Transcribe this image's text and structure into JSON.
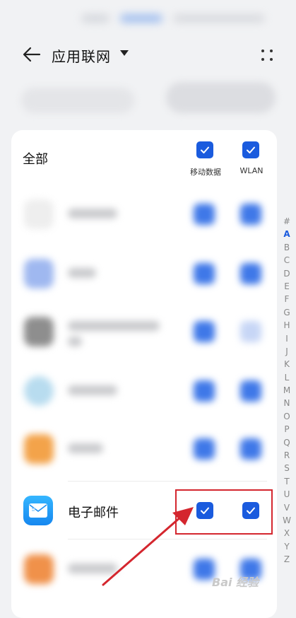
{
  "header": {
    "title": "应用联网"
  },
  "list": {
    "all_label": "全部",
    "columns": [
      "移动数据",
      "WLAN"
    ],
    "app": {
      "name": "电子邮件",
      "mobile_data": true,
      "wlan": true
    }
  },
  "index_letters": [
    "#",
    "A",
    "B",
    "C",
    "D",
    "E",
    "F",
    "G",
    "H",
    "I",
    "J",
    "K",
    "L",
    "M",
    "N",
    "O",
    "P",
    "Q",
    "R",
    "S",
    "T",
    "U",
    "V",
    "W",
    "X",
    "Y",
    "Z"
  ],
  "active_letter": "A",
  "watermark": "Bai 经验",
  "colors": {
    "accent": "#1a5bde",
    "highlight": "#d4262e",
    "arrow": "#d4262e"
  }
}
